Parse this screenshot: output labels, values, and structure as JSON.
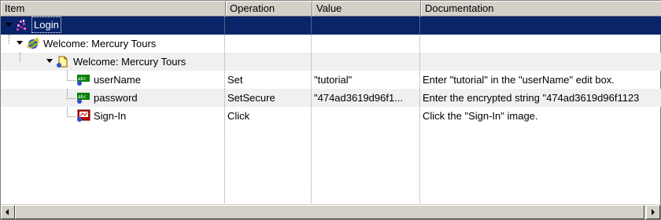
{
  "columns": [
    "Item",
    "Operation",
    "Value",
    "Documentation"
  ],
  "rows": [
    {
      "item": "Login",
      "operation": "",
      "value": "",
      "documentation": "",
      "icon": "action-icon",
      "level": 0,
      "selected": true
    },
    {
      "item": "Welcome: Mercury Tours",
      "operation": "",
      "value": "",
      "documentation": "",
      "icon": "browser-icon",
      "level": 1
    },
    {
      "item": "Welcome: Mercury Tours",
      "operation": "",
      "value": "",
      "documentation": "",
      "icon": "page-icon",
      "level": 2
    },
    {
      "item": "userName",
      "operation": "Set",
      "value": "\"tutorial\"",
      "documentation": "Enter \"tutorial\" in the \"userName\" edit box.",
      "icon": "edit-box-icon",
      "level": 3
    },
    {
      "item": "password",
      "operation": "SetSecure",
      "value": "\"474ad3619d96f1...",
      "documentation": "Enter the encrypted string \"474ad3619d96f1123",
      "icon": "edit-box-icon",
      "level": 3
    },
    {
      "item": "Sign-In",
      "operation": "Click",
      "value": "",
      "documentation": "Click the \"Sign-In\" image.",
      "icon": "image-icon",
      "level": 3
    }
  ],
  "colors": {
    "header": "#d4d0c8",
    "selection": "#0a246a"
  }
}
